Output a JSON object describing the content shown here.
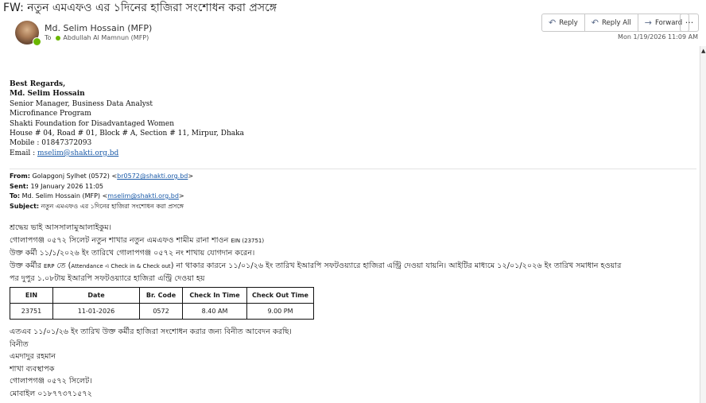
{
  "header": {
    "subject": "FW: নতুন এমএফও এর ১দিনের হাজিরা সংশোধন করা প্রসঙ্গে",
    "sender_name": "Md. Selim Hossain (MFP)",
    "to_label": "To",
    "to_recipient": "Abdullah Al Mamnun (MFP)",
    "date": "Mon 1/19/2026 11:09 AM",
    "actions": {
      "reply": "Reply",
      "reply_all": "Reply All",
      "forward": "Forward",
      "more": "···"
    }
  },
  "signature": {
    "greeting": "Best Regards,",
    "name": "Md. Selim Hossain",
    "title": "Senior Manager, Business Data Analyst",
    "program": "Microfinance  Program",
    "org": "Shakti Foundation for Disadvantaged Women",
    "address": "House # 04, Road # 01, Block # A, Section # 11, Mirpur, Dhaka",
    "mobile": "Mobile : 01847372093",
    "email_label": "Email : ",
    "email": "mselim@shakti.org.bd"
  },
  "forward_header": {
    "from_label": "From:",
    "from_value": " Golapgonj Sylhet (0572) <",
    "from_email": "br0572@shakti.org.bd",
    "from_close": ">",
    "sent_label": "Sent:",
    "sent_value": " 19 January 2026 11:05",
    "to_label": "To:",
    "to_value": " Md. Selim Hossain (MFP) <",
    "to_email": "mselim@shakti.org.bd",
    "to_close": ">",
    "subject_label": "Subject:",
    "subject_value": " নতুন এমএফও এর ১দিনের হাজিরা সংশোধন করা প্রসঙ্গে"
  },
  "body": {
    "salutation": "শ্রদ্ধেয় ভাই আসসালামুআলাইকুম।",
    "line1_main": "গোলাপগঞ্জ ০৫৭২ সিলেট নতুন শাখার নতুন এমএফও শামীম রানা শাওন ",
    "line1_small": "EIN (23751)",
    "line2": "উক্ত কর্মী ১১/১/২০২৬ ইং তারিখে গোলাপগঞ্জ ০৫৭২ নং শাখায় যোগদান করেন।",
    "line3a": "উক্ত কর্মীর ",
    "line3_small1": "ERP",
    "line3b": " তে (",
    "line3_small2": "Attendance এ Check in & Check out",
    "line3c": ") না থাকার কারনে ১১/০১/২৬ ইং তারিখ ইআরপি সফটওয়্যারে হাজিরা এন্ট্রি দেওয়া যায়নি। আইটির মাধ্যমে ১২/০১/২০২৬ ইং তারিখ সমাধান হওয়ার",
    "line4": "পর দুপুর ১.০৮টায় ইআরপি সফটওয়্যারে হাজিরা এন্ট্রি দেওয়া হয়"
  },
  "table": {
    "headers": [
      "EIN",
      "Date",
      "Br. Code",
      "Check In Time",
      "Check Out Time"
    ],
    "rows": [
      [
        "23751",
        "11-01-2026",
        "0572",
        "8.40 AM",
        "9.00 PM"
      ]
    ]
  },
  "closing": {
    "request": "এতএব ১১/০১/২৬ ইং তারিখ উক্ত কর্মীর হাজিরা সংশোধন করার জন্য বিনীত আবেদন করছি।",
    "sincerely": "বিনীত",
    "name": "এমদাদুর রহমান",
    "position": "শাখা ব্যবস্থাপক",
    "branch": "গোলাপগঞ্জ ০৫৭২ সিলেট।",
    "mobile": "মোবাইল ০১৮৭৭৩৭১৫৭২"
  },
  "icons": {
    "reply": "reply-arrow",
    "reply_all": "reply-all-arrow",
    "forward": "forward-arrow"
  },
  "colors": {
    "link": "#1a5aa8",
    "presence": "#6bb700"
  }
}
